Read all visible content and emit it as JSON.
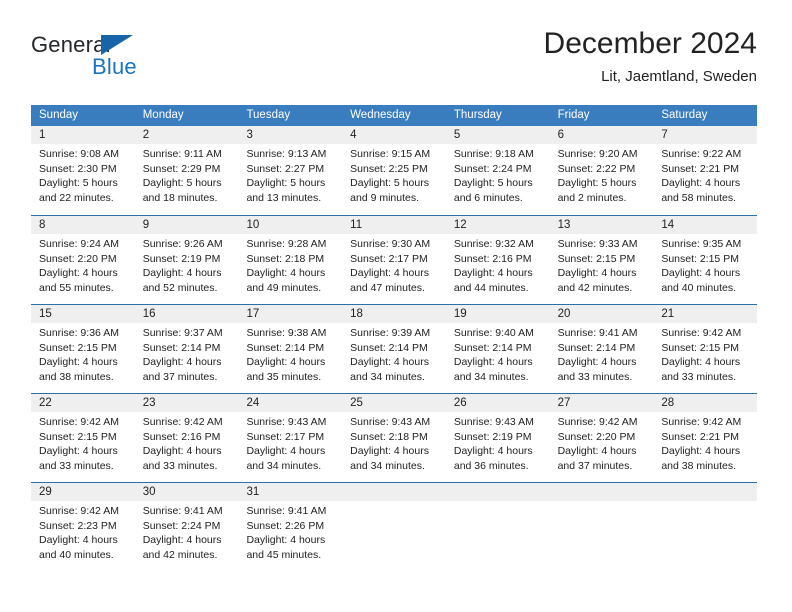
{
  "brand": {
    "name_part1": "General",
    "name_part2": "Blue",
    "primary_color": "#1b74bd",
    "triangle_color": "#1565a8"
  },
  "header": {
    "title": "December 2024",
    "subtitle": "Lit, Jaemtland, Sweden"
  },
  "calendar": {
    "header_bg": "#3a7dbf",
    "day_band_bg": "#efefef",
    "weekdays": [
      "Sunday",
      "Monday",
      "Tuesday",
      "Wednesday",
      "Thursday",
      "Friday",
      "Saturday"
    ],
    "weeks": [
      [
        {
          "day": "1",
          "sunrise": "Sunrise: 9:08 AM",
          "sunset": "Sunset: 2:30 PM",
          "daylight_1": "Daylight: 5 hours",
          "daylight_2": "and 22 minutes."
        },
        {
          "day": "2",
          "sunrise": "Sunrise: 9:11 AM",
          "sunset": "Sunset: 2:29 PM",
          "daylight_1": "Daylight: 5 hours",
          "daylight_2": "and 18 minutes."
        },
        {
          "day": "3",
          "sunrise": "Sunrise: 9:13 AM",
          "sunset": "Sunset: 2:27 PM",
          "daylight_1": "Daylight: 5 hours",
          "daylight_2": "and 13 minutes."
        },
        {
          "day": "4",
          "sunrise": "Sunrise: 9:15 AM",
          "sunset": "Sunset: 2:25 PM",
          "daylight_1": "Daylight: 5 hours",
          "daylight_2": "and 9 minutes."
        },
        {
          "day": "5",
          "sunrise": "Sunrise: 9:18 AM",
          "sunset": "Sunset: 2:24 PM",
          "daylight_1": "Daylight: 5 hours",
          "daylight_2": "and 6 minutes."
        },
        {
          "day": "6",
          "sunrise": "Sunrise: 9:20 AM",
          "sunset": "Sunset: 2:22 PM",
          "daylight_1": "Daylight: 5 hours",
          "daylight_2": "and 2 minutes."
        },
        {
          "day": "7",
          "sunrise": "Sunrise: 9:22 AM",
          "sunset": "Sunset: 2:21 PM",
          "daylight_1": "Daylight: 4 hours",
          "daylight_2": "and 58 minutes."
        }
      ],
      [
        {
          "day": "8",
          "sunrise": "Sunrise: 9:24 AM",
          "sunset": "Sunset: 2:20 PM",
          "daylight_1": "Daylight: 4 hours",
          "daylight_2": "and 55 minutes."
        },
        {
          "day": "9",
          "sunrise": "Sunrise: 9:26 AM",
          "sunset": "Sunset: 2:19 PM",
          "daylight_1": "Daylight: 4 hours",
          "daylight_2": "and 52 minutes."
        },
        {
          "day": "10",
          "sunrise": "Sunrise: 9:28 AM",
          "sunset": "Sunset: 2:18 PM",
          "daylight_1": "Daylight: 4 hours",
          "daylight_2": "and 49 minutes."
        },
        {
          "day": "11",
          "sunrise": "Sunrise: 9:30 AM",
          "sunset": "Sunset: 2:17 PM",
          "daylight_1": "Daylight: 4 hours",
          "daylight_2": "and 47 minutes."
        },
        {
          "day": "12",
          "sunrise": "Sunrise: 9:32 AM",
          "sunset": "Sunset: 2:16 PM",
          "daylight_1": "Daylight: 4 hours",
          "daylight_2": "and 44 minutes."
        },
        {
          "day": "13",
          "sunrise": "Sunrise: 9:33 AM",
          "sunset": "Sunset: 2:15 PM",
          "daylight_1": "Daylight: 4 hours",
          "daylight_2": "and 42 minutes."
        },
        {
          "day": "14",
          "sunrise": "Sunrise: 9:35 AM",
          "sunset": "Sunset: 2:15 PM",
          "daylight_1": "Daylight: 4 hours",
          "daylight_2": "and 40 minutes."
        }
      ],
      [
        {
          "day": "15",
          "sunrise": "Sunrise: 9:36 AM",
          "sunset": "Sunset: 2:15 PM",
          "daylight_1": "Daylight: 4 hours",
          "daylight_2": "and 38 minutes."
        },
        {
          "day": "16",
          "sunrise": "Sunrise: 9:37 AM",
          "sunset": "Sunset: 2:14 PM",
          "daylight_1": "Daylight: 4 hours",
          "daylight_2": "and 37 minutes."
        },
        {
          "day": "17",
          "sunrise": "Sunrise: 9:38 AM",
          "sunset": "Sunset: 2:14 PM",
          "daylight_1": "Daylight: 4 hours",
          "daylight_2": "and 35 minutes."
        },
        {
          "day": "18",
          "sunrise": "Sunrise: 9:39 AM",
          "sunset": "Sunset: 2:14 PM",
          "daylight_1": "Daylight: 4 hours",
          "daylight_2": "and 34 minutes."
        },
        {
          "day": "19",
          "sunrise": "Sunrise: 9:40 AM",
          "sunset": "Sunset: 2:14 PM",
          "daylight_1": "Daylight: 4 hours",
          "daylight_2": "and 34 minutes."
        },
        {
          "day": "20",
          "sunrise": "Sunrise: 9:41 AM",
          "sunset": "Sunset: 2:14 PM",
          "daylight_1": "Daylight: 4 hours",
          "daylight_2": "and 33 minutes."
        },
        {
          "day": "21",
          "sunrise": "Sunrise: 9:42 AM",
          "sunset": "Sunset: 2:15 PM",
          "daylight_1": "Daylight: 4 hours",
          "daylight_2": "and 33 minutes."
        }
      ],
      [
        {
          "day": "22",
          "sunrise": "Sunrise: 9:42 AM",
          "sunset": "Sunset: 2:15 PM",
          "daylight_1": "Daylight: 4 hours",
          "daylight_2": "and 33 minutes."
        },
        {
          "day": "23",
          "sunrise": "Sunrise: 9:42 AM",
          "sunset": "Sunset: 2:16 PM",
          "daylight_1": "Daylight: 4 hours",
          "daylight_2": "and 33 minutes."
        },
        {
          "day": "24",
          "sunrise": "Sunrise: 9:43 AM",
          "sunset": "Sunset: 2:17 PM",
          "daylight_1": "Daylight: 4 hours",
          "daylight_2": "and 34 minutes."
        },
        {
          "day": "25",
          "sunrise": "Sunrise: 9:43 AM",
          "sunset": "Sunset: 2:18 PM",
          "daylight_1": "Daylight: 4 hours",
          "daylight_2": "and 34 minutes."
        },
        {
          "day": "26",
          "sunrise": "Sunrise: 9:43 AM",
          "sunset": "Sunset: 2:19 PM",
          "daylight_1": "Daylight: 4 hours",
          "daylight_2": "and 36 minutes."
        },
        {
          "day": "27",
          "sunrise": "Sunrise: 9:42 AM",
          "sunset": "Sunset: 2:20 PM",
          "daylight_1": "Daylight: 4 hours",
          "daylight_2": "and 37 minutes."
        },
        {
          "day": "28",
          "sunrise": "Sunrise: 9:42 AM",
          "sunset": "Sunset: 2:21 PM",
          "daylight_1": "Daylight: 4 hours",
          "daylight_2": "and 38 minutes."
        }
      ],
      [
        {
          "day": "29",
          "sunrise": "Sunrise: 9:42 AM",
          "sunset": "Sunset: 2:23 PM",
          "daylight_1": "Daylight: 4 hours",
          "daylight_2": "and 40 minutes."
        },
        {
          "day": "30",
          "sunrise": "Sunrise: 9:41 AM",
          "sunset": "Sunset: 2:24 PM",
          "daylight_1": "Daylight: 4 hours",
          "daylight_2": "and 42 minutes."
        },
        {
          "day": "31",
          "sunrise": "Sunrise: 9:41 AM",
          "sunset": "Sunset: 2:26 PM",
          "daylight_1": "Daylight: 4 hours",
          "daylight_2": "and 45 minutes."
        },
        {
          "day": "",
          "sunrise": "",
          "sunset": "",
          "daylight_1": "",
          "daylight_2": ""
        },
        {
          "day": "",
          "sunrise": "",
          "sunset": "",
          "daylight_1": "",
          "daylight_2": ""
        },
        {
          "day": "",
          "sunrise": "",
          "sunset": "",
          "daylight_1": "",
          "daylight_2": ""
        },
        {
          "day": "",
          "sunrise": "",
          "sunset": "",
          "daylight_1": "",
          "daylight_2": ""
        }
      ]
    ]
  }
}
